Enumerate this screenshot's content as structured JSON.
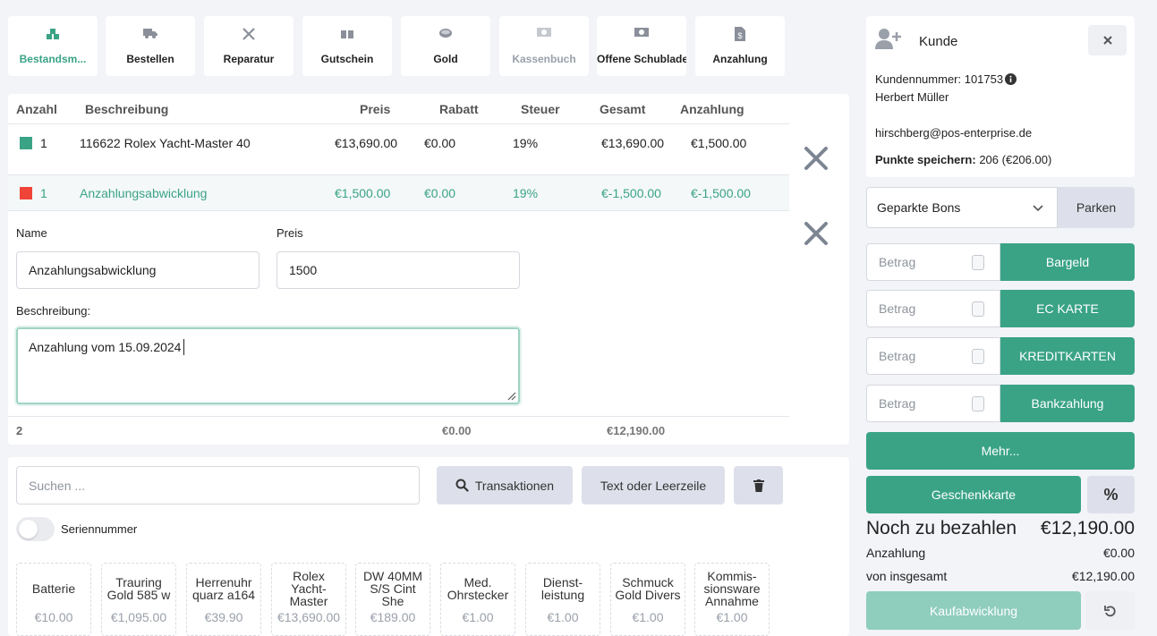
{
  "toolbar": {
    "tiles": [
      {
        "label": "Bestandsm...",
        "icon": "boxes-icon",
        "state": "active"
      },
      {
        "label": "Bestellen",
        "icon": "truck-icon",
        "state": "normal"
      },
      {
        "label": "Reparatur",
        "icon": "tools-icon",
        "state": "normal"
      },
      {
        "label": "Gutschein",
        "icon": "gift-icon",
        "state": "normal"
      },
      {
        "label": "Gold",
        "icon": "coin-icon",
        "state": "normal"
      },
      {
        "label": "Kassenbuch",
        "icon": "money-icon",
        "state": "disabled"
      },
      {
        "label": "Offene Schublade",
        "icon": "money-icon",
        "state": "normal"
      },
      {
        "label": "Anzahlung",
        "icon": "invoice-icon",
        "state": "normal"
      }
    ]
  },
  "cart": {
    "headers": {
      "qty": "Anzahl",
      "desc": "Beschreibung",
      "price": "Preis",
      "discount": "Rabatt",
      "tax": "Steuer",
      "total": "Gesamt",
      "deposit": "Anzahlung"
    },
    "rows": [
      {
        "color": "#3aa386",
        "qty": "1",
        "desc": "116622 Rolex Yacht-Master 40",
        "price": "€13,690.00",
        "discount": "€0.00",
        "tax": "19%",
        "total": "€13,690.00",
        "deposit": "€1,500.00"
      },
      {
        "color": "#f04438",
        "qty": "1",
        "desc": "Anzahlungsabwicklung",
        "price": "€1,500.00",
        "discount": "€0.00",
        "tax": "19%",
        "total": "€-1,500.00",
        "deposit": "€-1,500.00"
      }
    ],
    "edit": {
      "name_label": "Name",
      "name_value": "Anzahlungsabwicklung",
      "price_label": "Preis",
      "price_value": "1500",
      "desc_label": "Beschreibung:",
      "desc_value": "Anzahlung vom 15.09.2024"
    },
    "footer": {
      "count": "2",
      "discount": "€0.00",
      "total": "€12,190.00"
    }
  },
  "search": {
    "placeholder": "Suchen ...",
    "transactions_label": "Transaktionen",
    "text_label": "Text oder Leerzeile",
    "serial_label": "Seriennummer"
  },
  "products": [
    {
      "name": "Batterie",
      "price": "€10.00"
    },
    {
      "name": "Trauring Gold 585 w",
      "price": "€1,095.00"
    },
    {
      "name": "Herrenuhr quarz a164",
      "price": "€39.90"
    },
    {
      "name": "Rolex Yacht-Master",
      "price": "€13,690.00"
    },
    {
      "name": "DW 40MM S/S Cint She",
      "price": "€189.00"
    },
    {
      "name": "Med. Ohrstecker",
      "price": "€1.00"
    },
    {
      "name": "Dienst-leistung",
      "price": "€1.00"
    },
    {
      "name": "Schmuck Gold Divers",
      "price": "€1.00"
    },
    {
      "name": "Kommis-sionsware Annahme",
      "price": "€1.00"
    }
  ],
  "customer": {
    "title": "Kunde",
    "number_label": "Kundennummer: 101753",
    "name": "Herbert Müller",
    "email": "hirschberg@pos-enterprise.de",
    "points_label": "Punkte speichern:",
    "points_value": "206 (€206.00)"
  },
  "parked": {
    "select_value": "Geparkte Bons",
    "park_label": "Parken"
  },
  "payments": {
    "amount_placeholder": "Betrag",
    "methods": [
      "Bargeld",
      "EC KARTE",
      "KREDITKARTEN",
      "Bankzahlung"
    ],
    "more_label": "Mehr...",
    "giftcard_label": "Geschenkkarte",
    "percent_label": "%"
  },
  "summary": {
    "due_label": "Noch zu bezahlen",
    "due_value": "€12,190.00",
    "deposit_label": "Anzahlung",
    "deposit_value": "€0.00",
    "total_label": "von insgesamt",
    "total_value": "€12,190.00",
    "checkout_label": "Kaufabwicklung"
  },
  "colors": {
    "accent": "#3aa386",
    "danger": "#f04438",
    "accent_light": "#8fcdbd"
  }
}
